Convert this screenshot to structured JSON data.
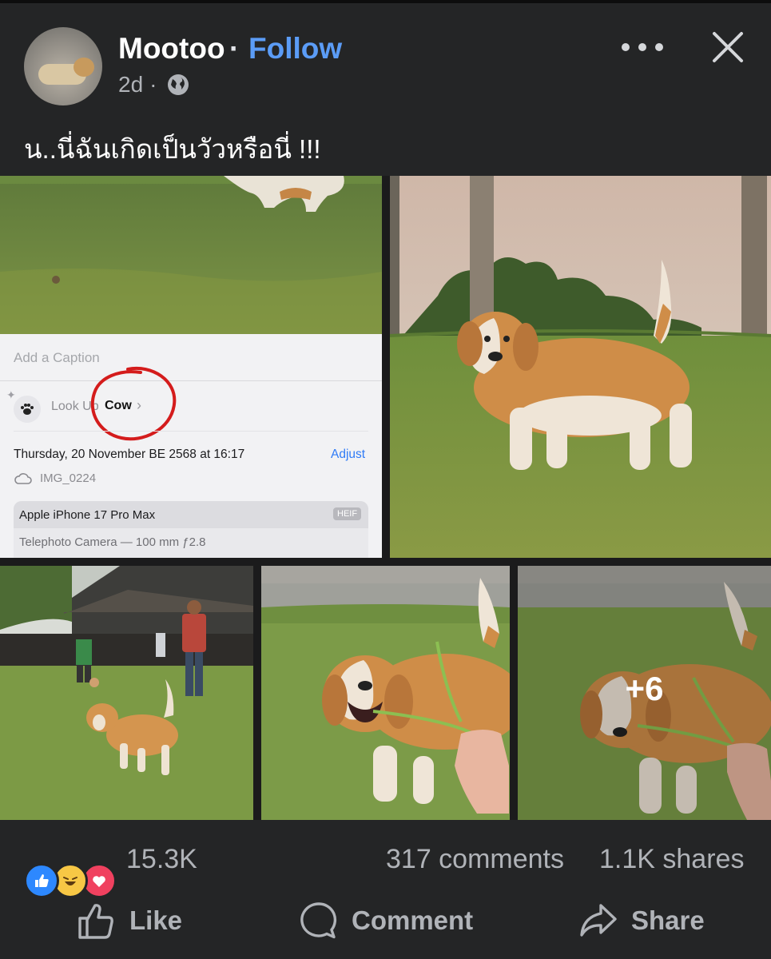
{
  "post": {
    "author": "Mootoo",
    "separator": "·",
    "follow_label": "Follow",
    "time": "2d",
    "time_separator": "·",
    "caption": "น..นี่ฉันเกิดเป็นวัวหรือนี่ !!!"
  },
  "embedded_screenshot": {
    "caption_placeholder": "Add a Caption",
    "lookup_label": "Look Up",
    "lookup_value": "Cow",
    "date_time": "Thursday, 20 November BE 2568 at 16:17",
    "adjust_label": "Adjust",
    "file_name": "IMG_0224",
    "device": "Apple iPhone 17 Pro Max",
    "format_badge": "HEIF",
    "lens": "Telephoto Camera — 100 mm ƒ2.8"
  },
  "gallery": {
    "more_label": "+6"
  },
  "stats": {
    "reactions_count": "15.3K",
    "comments": "317 comments",
    "shares": "1.1K shares"
  },
  "actions": {
    "like": "Like",
    "comment": "Comment",
    "share": "Share"
  },
  "colors": {
    "background": "#242526",
    "follow": "#5b9cf6",
    "like_reaction": "#2d88ff",
    "love_reaction": "#f0415f",
    "haha_reaction": "#f7c745"
  }
}
